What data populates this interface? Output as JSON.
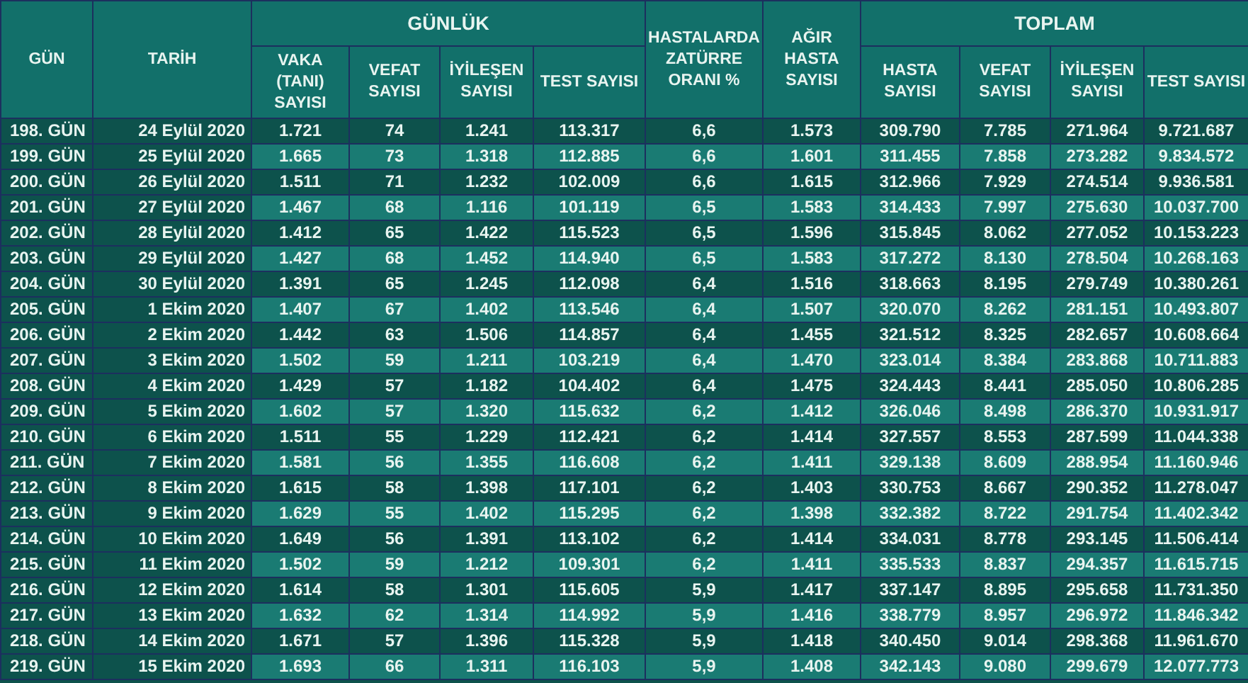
{
  "table": {
    "header_groups": [
      {
        "label": "GÜN",
        "rowspan": 2
      },
      {
        "label": "TARİH",
        "rowspan": 2
      },
      {
        "label": "GÜNLÜK",
        "colspan": 4
      },
      {
        "label": "HASTALARDA ZATÜRRE ORANI %",
        "rowspan": 2
      },
      {
        "label": "AĞIR HASTA SAYISI",
        "rowspan": 2
      },
      {
        "label": "TOPLAM",
        "colspan": 4
      }
    ],
    "subcolumns": [
      "VAKA (TANI) SAYISI",
      "VEFAT SAYISI",
      "İYİLEŞEN SAYISI",
      "TEST SAYISI",
      "HASTA SAYISI",
      "VEFAT SAYISI",
      "İYİLEŞEN SAYISI",
      "TEST SAYISI"
    ],
    "rows": [
      [
        "198. GÜN",
        "24 Eylül 2020",
        "1.721",
        "74",
        "1.241",
        "113.317",
        "6,6",
        "1.573",
        "309.790",
        "7.785",
        "271.964",
        "9.721.687"
      ],
      [
        "199. GÜN",
        "25 Eylül 2020",
        "1.665",
        "73",
        "1.318",
        "112.885",
        "6,6",
        "1.601",
        "311.455",
        "7.858",
        "273.282",
        "9.834.572"
      ],
      [
        "200. GÜN",
        "26 Eylül 2020",
        "1.511",
        "71",
        "1.232",
        "102.009",
        "6,6",
        "1.615",
        "312.966",
        "7.929",
        "274.514",
        "9.936.581"
      ],
      [
        "201. GÜN",
        "27 Eylül 2020",
        "1.467",
        "68",
        "1.116",
        "101.119",
        "6,5",
        "1.583",
        "314.433",
        "7.997",
        "275.630",
        "10.037.700"
      ],
      [
        "202. GÜN",
        "28 Eylül 2020",
        "1.412",
        "65",
        "1.422",
        "115.523",
        "6,5",
        "1.596",
        "315.845",
        "8.062",
        "277.052",
        "10.153.223"
      ],
      [
        "203. GÜN",
        "29 Eylül 2020",
        "1.427",
        "68",
        "1.452",
        "114.940",
        "6,5",
        "1.583",
        "317.272",
        "8.130",
        "278.504",
        "10.268.163"
      ],
      [
        "204. GÜN",
        "30 Eylül 2020",
        "1.391",
        "65",
        "1.245",
        "112.098",
        "6,4",
        "1.516",
        "318.663",
        "8.195",
        "279.749",
        "10.380.261"
      ],
      [
        "205. GÜN",
        "1 Ekim 2020",
        "1.407",
        "67",
        "1.402",
        "113.546",
        "6,4",
        "1.507",
        "320.070",
        "8.262",
        "281.151",
        "10.493.807"
      ],
      [
        "206. GÜN",
        "2 Ekim 2020",
        "1.442",
        "63",
        "1.506",
        "114.857",
        "6,4",
        "1.455",
        "321.512",
        "8.325",
        "282.657",
        "10.608.664"
      ],
      [
        "207. GÜN",
        "3 Ekim 2020",
        "1.502",
        "59",
        "1.211",
        "103.219",
        "6,4",
        "1.470",
        "323.014",
        "8.384",
        "283.868",
        "10.711.883"
      ],
      [
        "208. GÜN",
        "4 Ekim 2020",
        "1.429",
        "57",
        "1.182",
        "104.402",
        "6,4",
        "1.475",
        "324.443",
        "8.441",
        "285.050",
        "10.806.285"
      ],
      [
        "209. GÜN",
        "5 Ekim 2020",
        "1.602",
        "57",
        "1.320",
        "115.632",
        "6,2",
        "1.412",
        "326.046",
        "8.498",
        "286.370",
        "10.931.917"
      ],
      [
        "210. GÜN",
        "6 Ekim 2020",
        "1.511",
        "55",
        "1.229",
        "112.421",
        "6,2",
        "1.414",
        "327.557",
        "8.553",
        "287.599",
        "11.044.338"
      ],
      [
        "211. GÜN",
        "7 Ekim 2020",
        "1.581",
        "56",
        "1.355",
        "116.608",
        "6,2",
        "1.411",
        "329.138",
        "8.609",
        "288.954",
        "11.160.946"
      ],
      [
        "212. GÜN",
        "8 Ekim 2020",
        "1.615",
        "58",
        "1.398",
        "117.101",
        "6,2",
        "1.403",
        "330.753",
        "8.667",
        "290.352",
        "11.278.047"
      ],
      [
        "213. GÜN",
        "9 Ekim 2020",
        "1.629",
        "55",
        "1.402",
        "115.295",
        "6,2",
        "1.398",
        "332.382",
        "8.722",
        "291.754",
        "11.402.342"
      ],
      [
        "214. GÜN",
        "10 Ekim 2020",
        "1.649",
        "56",
        "1.391",
        "113.102",
        "6,2",
        "1.414",
        "334.031",
        "8.778",
        "293.145",
        "11.506.414"
      ],
      [
        "215. GÜN",
        "11 Ekim 2020",
        "1.502",
        "59",
        "1.212",
        "109.301",
        "6,2",
        "1.411",
        "335.533",
        "8.837",
        "294.357",
        "11.615.715"
      ],
      [
        "216. GÜN",
        "12 Ekim 2020",
        "1.614",
        "58",
        "1.301",
        "115.605",
        "5,9",
        "1.417",
        "337.147",
        "8.895",
        "295.658",
        "11.731.350"
      ],
      [
        "217. GÜN",
        "13 Ekim 2020",
        "1.632",
        "62",
        "1.314",
        "114.992",
        "5,9",
        "1.416",
        "338.779",
        "8.957",
        "296.972",
        "11.846.342"
      ],
      [
        "218. GÜN",
        "14 Ekim 2020",
        "1.671",
        "57",
        "1.396",
        "115.328",
        "5,9",
        "1.418",
        "340.450",
        "9.014",
        "298.368",
        "11.961.670"
      ],
      [
        "219. GÜN",
        "15 Ekim 2020",
        "1.693",
        "66",
        "1.311",
        "116.103",
        "5,9",
        "1.408",
        "342.143",
        "9.080",
        "299.679",
        "12.077.773"
      ]
    ]
  }
}
